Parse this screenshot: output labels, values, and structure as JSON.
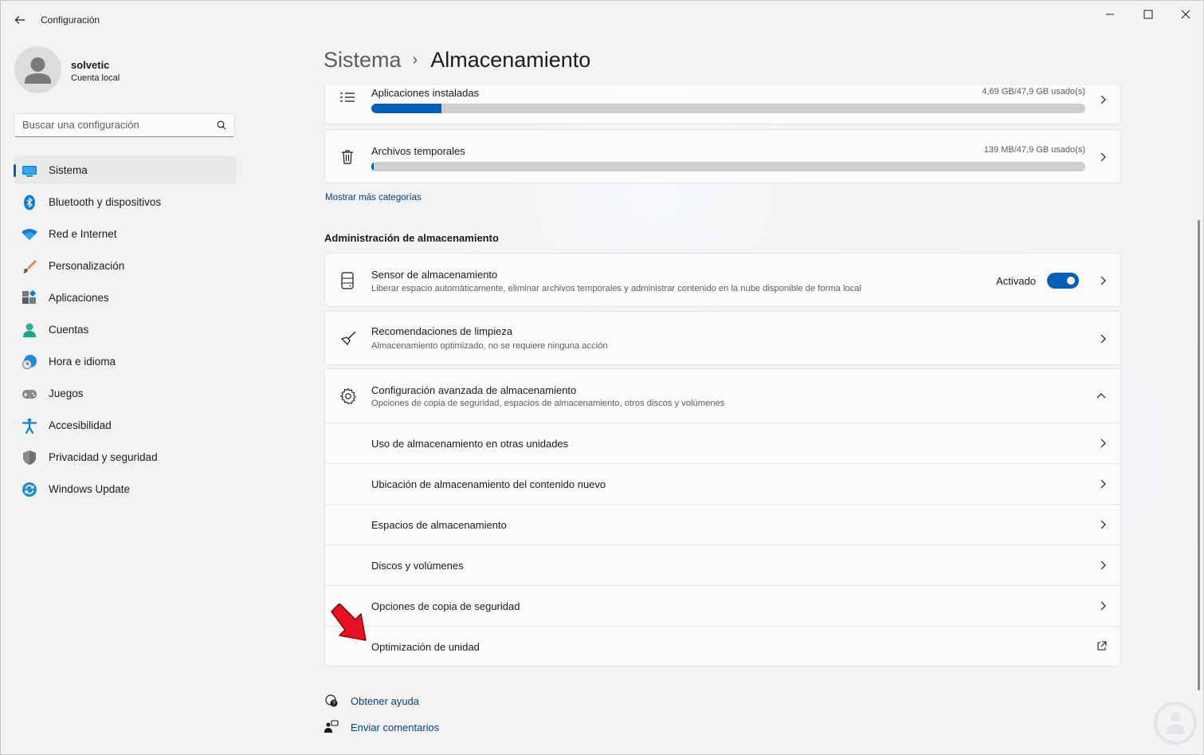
{
  "window": {
    "title": "Configuración"
  },
  "profile": {
    "name": "solvetic",
    "account_type": "Cuenta local"
  },
  "search": {
    "placeholder": "Buscar una configuración"
  },
  "sidebar": {
    "items": [
      {
        "label": "Sistema",
        "icon": "system-icon",
        "active": true
      },
      {
        "label": "Bluetooth y dispositivos",
        "icon": "bluetooth-icon"
      },
      {
        "label": "Red e Internet",
        "icon": "wifi-icon"
      },
      {
        "label": "Personalización",
        "icon": "brush-icon"
      },
      {
        "label": "Aplicaciones",
        "icon": "apps-icon"
      },
      {
        "label": "Cuentas",
        "icon": "account-icon"
      },
      {
        "label": "Hora e idioma",
        "icon": "clock-globe-icon"
      },
      {
        "label": "Juegos",
        "icon": "gamepad-icon"
      },
      {
        "label": "Accesibilidad",
        "icon": "accessibility-icon"
      },
      {
        "label": "Privacidad y seguridad",
        "icon": "shield-icon"
      },
      {
        "label": "Windows Update",
        "icon": "update-icon"
      }
    ]
  },
  "header": {
    "parent": "Sistema",
    "separator": "›",
    "current": "Almacenamiento"
  },
  "storage_categories": [
    {
      "label": "Aplicaciones instaladas",
      "usage": "4,69 GB/47,9 GB usado(s)",
      "fill_fraction": 0.098,
      "icon": "list-icon"
    },
    {
      "label": "Archivos temporales",
      "usage": "139 MB/47,9 GB usado(s)",
      "fill_fraction": 0.003,
      "icon": "trash-icon"
    }
  ],
  "show_more_link": "Mostrar más categorías",
  "management": {
    "section_title": "Administración de almacenamiento",
    "sensor": {
      "title": "Sensor de almacenamiento",
      "description": "Liberar espacio automáticamente, eliminar archivos temporales y administrar contenido en la nube disponible de forma local",
      "toggle_state": "Activado",
      "toggle_on": true
    },
    "cleanup": {
      "title": "Recomendaciones de limpieza",
      "description": "Almacenamiento optimizado, no se requiere ninguna acción"
    },
    "advanced": {
      "title": "Configuración avanzada de almacenamiento",
      "description": "Opciones de copia de seguridad, espacios de almacenamiento, otros discos y volúmenes",
      "expanded": true,
      "items": [
        {
          "label": "Uso de almacenamiento en otras unidades",
          "icon": "chevron-right-icon"
        },
        {
          "label": "Ubicación de almacenamiento del contenido nuevo",
          "icon": "chevron-right-icon"
        },
        {
          "label": "Espacios de almacenamiento",
          "icon": "chevron-right-icon"
        },
        {
          "label": "Discos y volúmenes",
          "icon": "chevron-right-icon"
        },
        {
          "label": "Opciones de copia de seguridad",
          "icon": "chevron-right-icon"
        },
        {
          "label": "Optimización de unidad",
          "icon": "external-link-icon"
        }
      ]
    }
  },
  "help_links": {
    "get_help": "Obtener ayuda",
    "feedback": "Enviar comentarios"
  },
  "colors": {
    "accent": "#005fb8",
    "link": "#003e92",
    "annotation_arrow": "#e81123"
  }
}
